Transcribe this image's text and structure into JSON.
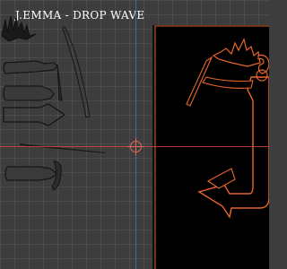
{
  "title": "J.EMMA - DROP WAVE",
  "colors": {
    "workspace": "#3d3d3d",
    "artboard": "#000000",
    "selection": "#e8662c",
    "x_axis": "#d2453a",
    "y_axis": "#3e6fb0"
  },
  "icons": [
    "origin-crosshair-icon"
  ]
}
